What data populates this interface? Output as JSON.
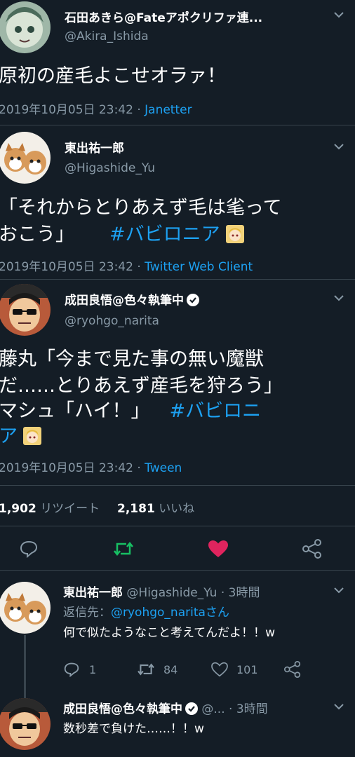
{
  "tweets": [
    {
      "name": "石田あきら@Fateアポクリファ連...",
      "handle": "@Akira_Ishida",
      "lines": [
        "原初の産毛よこせオラァ！"
      ],
      "timestamp": "2019年10月05日 23:42 · ",
      "source": "Janetter"
    },
    {
      "name": "東出祐一郎",
      "handle": "@Higashide_Yu",
      "line1": "「それからとりあえず毛は毟って",
      "line2_text": "おこう」",
      "line2_hashtag": "#バビロニア",
      "timestamp": "2019年10月05日 23:42 · ",
      "source": "Twitter Web Client"
    },
    {
      "name": "成田良悟@色々執筆中",
      "handle": "@ryohgo_narita",
      "line1": "藤丸「今まで見た事の無い魔獣",
      "line2": "だ……とりあえず産毛を狩ろう」",
      "line3_text": "マシュ「ハイ！」",
      "line3_hashtag": "#バビロニ",
      "line4_hashtag": "ア",
      "timestamp": "2019年10月05日 23:42 · ",
      "source": "Tween"
    }
  ],
  "stats": {
    "retweets": "1,902",
    "retweets_label": "リツイート",
    "likes": "2,181",
    "likes_label": "いいね"
  },
  "actions": {
    "reply_icon": "reply-icon",
    "retweet_icon": "retweet-icon",
    "like_icon": "heart-icon",
    "share_icon": "share-icon",
    "retweet_color": "#17bf63",
    "like_color": "#e0245e"
  },
  "replies": [
    {
      "name": "東出祐一郎",
      "handle": "@Higashide_Yu · 3時間",
      "reply_prefix": "返信先：",
      "reply_to": "@ryohgo_naritaさん",
      "text": "何で似たようなこと考えてんだよ！！w",
      "reply_count": "1",
      "retweet_count": "84",
      "like_count": "101"
    },
    {
      "name": "成田良悟@色々執筆中",
      "handle": "@... · 3時間",
      "text": "数秒差で負けた……！！w"
    }
  ]
}
